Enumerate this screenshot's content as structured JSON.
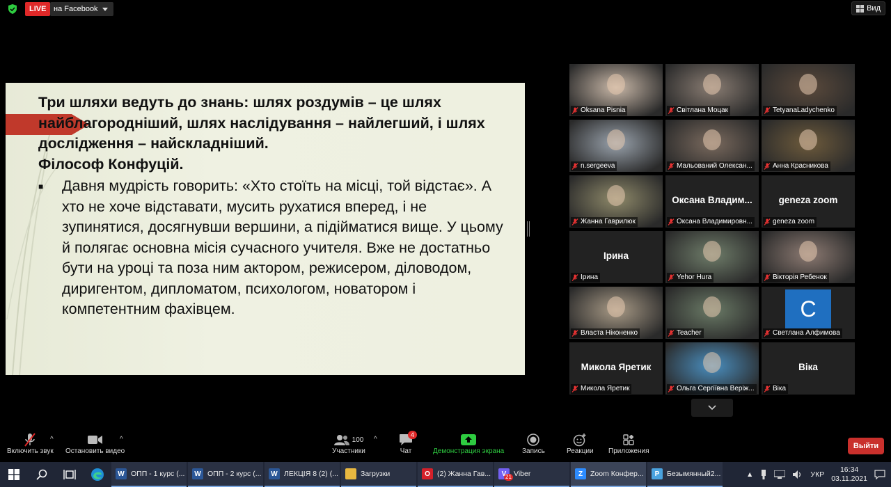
{
  "top": {
    "live_label": "LIVE",
    "live_destination": "на Facebook",
    "view_label": "Вид"
  },
  "slide": {
    "title": "Три шляхи ведуть до знань: шлях роздумів – це шлях найблагороднiший, шлях наслiдування – найлегший, i шлях дослiдження – найскладнiший.",
    "author": "Фiлософ Конфуцiй.",
    "bullet_mark": "■",
    "bullet_text": "Давня мудрiсть говорить: «Хто стоїть на мiсцi, той вiдстає». А хто не хоче вiдставати, мусить рухатися вперед, i не зупинятися, досягнувши вершини, а пiдiйматися вище. У цьому й полягає основна мiсiя сучасного учителя. Вже не достатньо бути на уроцi та поза ним актором, режисером, дiловодом, диригентом, дипломатом, психологом, новатором i компетентним фахiвцем."
  },
  "participants": [
    {
      "name": "Oksana Pisnia",
      "video": true,
      "color": "#c9b8a8"
    },
    {
      "name": "Свiтлана Моцак",
      "video": true,
      "color": "#8a7d73"
    },
    {
      "name": "TetyanaLadychenko",
      "video": true,
      "color": "#5b4a3c"
    },
    {
      "name": "n.sergeeva",
      "video": true,
      "color": "#9aa3ad"
    },
    {
      "name": "Мальований Олексан...",
      "video": true,
      "color": "#7a6a5e"
    },
    {
      "name": "Анна Красникова",
      "video": true,
      "color": "#6e5b3c"
    },
    {
      "name": "Жанна Гаврилюк",
      "video": true,
      "color": "#8f8a6a",
      "active": true
    },
    {
      "name": "Оксана Владимировн...",
      "video": false,
      "display": "Оксана  Владим..."
    },
    {
      "name": "geneza zoom",
      "video": false,
      "display": "geneza zoom"
    },
    {
      "name": "Iрина",
      "video": false,
      "display": "Iрина"
    },
    {
      "name": "Yehor Hura",
      "video": true,
      "color": "#6f7d6a"
    },
    {
      "name": "Вiкторiя Ребенок",
      "video": true,
      "color": "#8c7a72"
    },
    {
      "name": "Власта Нiконенко",
      "video": true,
      "color": "#a89a86"
    },
    {
      "name": "Teacher",
      "video": true,
      "color": "#6a7a66"
    },
    {
      "name": "Светлана Алфимова",
      "video": false,
      "avatar_letter": "C",
      "avatar_color": "#1f6fc0"
    },
    {
      "name": "Микола Яретик",
      "video": false,
      "display": "Микола Яретик"
    },
    {
      "name": "Ольга Сергiївна Верiж...",
      "video": true,
      "color": "#4a8fc0"
    },
    {
      "name": "Вiка",
      "video": false,
      "display": "Вiка"
    }
  ],
  "toolbar": {
    "mute_label": "Включить звук",
    "video_label": "Остановить видео",
    "participants_label": "Участники",
    "participants_count": "100",
    "chat_label": "Чат",
    "chat_badge": "4",
    "share_label": "Демонстрация экрана",
    "record_label": "Запись",
    "reactions_label": "Реакции",
    "apps_label": "Приложения",
    "leave_label": "Выйти",
    "share_color": "#2ecc40",
    "leave_color": "#c9302c"
  },
  "taskbar": {
    "apps": [
      {
        "label": "ОПП - 1 курс (...",
        "icon": "word-icon",
        "color": "#2b5797",
        "letter": "W"
      },
      {
        "label": "ОПП - 2 курс (...",
        "icon": "word-icon",
        "color": "#2b5797",
        "letter": "W"
      },
      {
        "label": "ЛЕКЦIЯ 8 (2) (...",
        "icon": "word-icon",
        "color": "#2b5797",
        "letter": "W"
      },
      {
        "label": "Загрузки",
        "icon": "folder-icon",
        "color": "#e8b840",
        "letter": ""
      },
      {
        "label": "(2) Жанна Гав...",
        "icon": "opera-icon",
        "color": "#d4202a",
        "letter": "O"
      },
      {
        "label": "Viber",
        "icon": "viber-icon",
        "color": "#7360f2",
        "letter": "V",
        "badge": "21"
      },
      {
        "label": "Zoom Конфер...",
        "icon": "zoom-icon",
        "color": "#2d8cff",
        "letter": "Z",
        "active": true
      },
      {
        "label": "Безымянный2...",
        "icon": "paint-icon",
        "color": "#4aa3df",
        "letter": "P"
      }
    ],
    "language": "УКР",
    "time": "16:34",
    "date": "03.11.2021"
  }
}
